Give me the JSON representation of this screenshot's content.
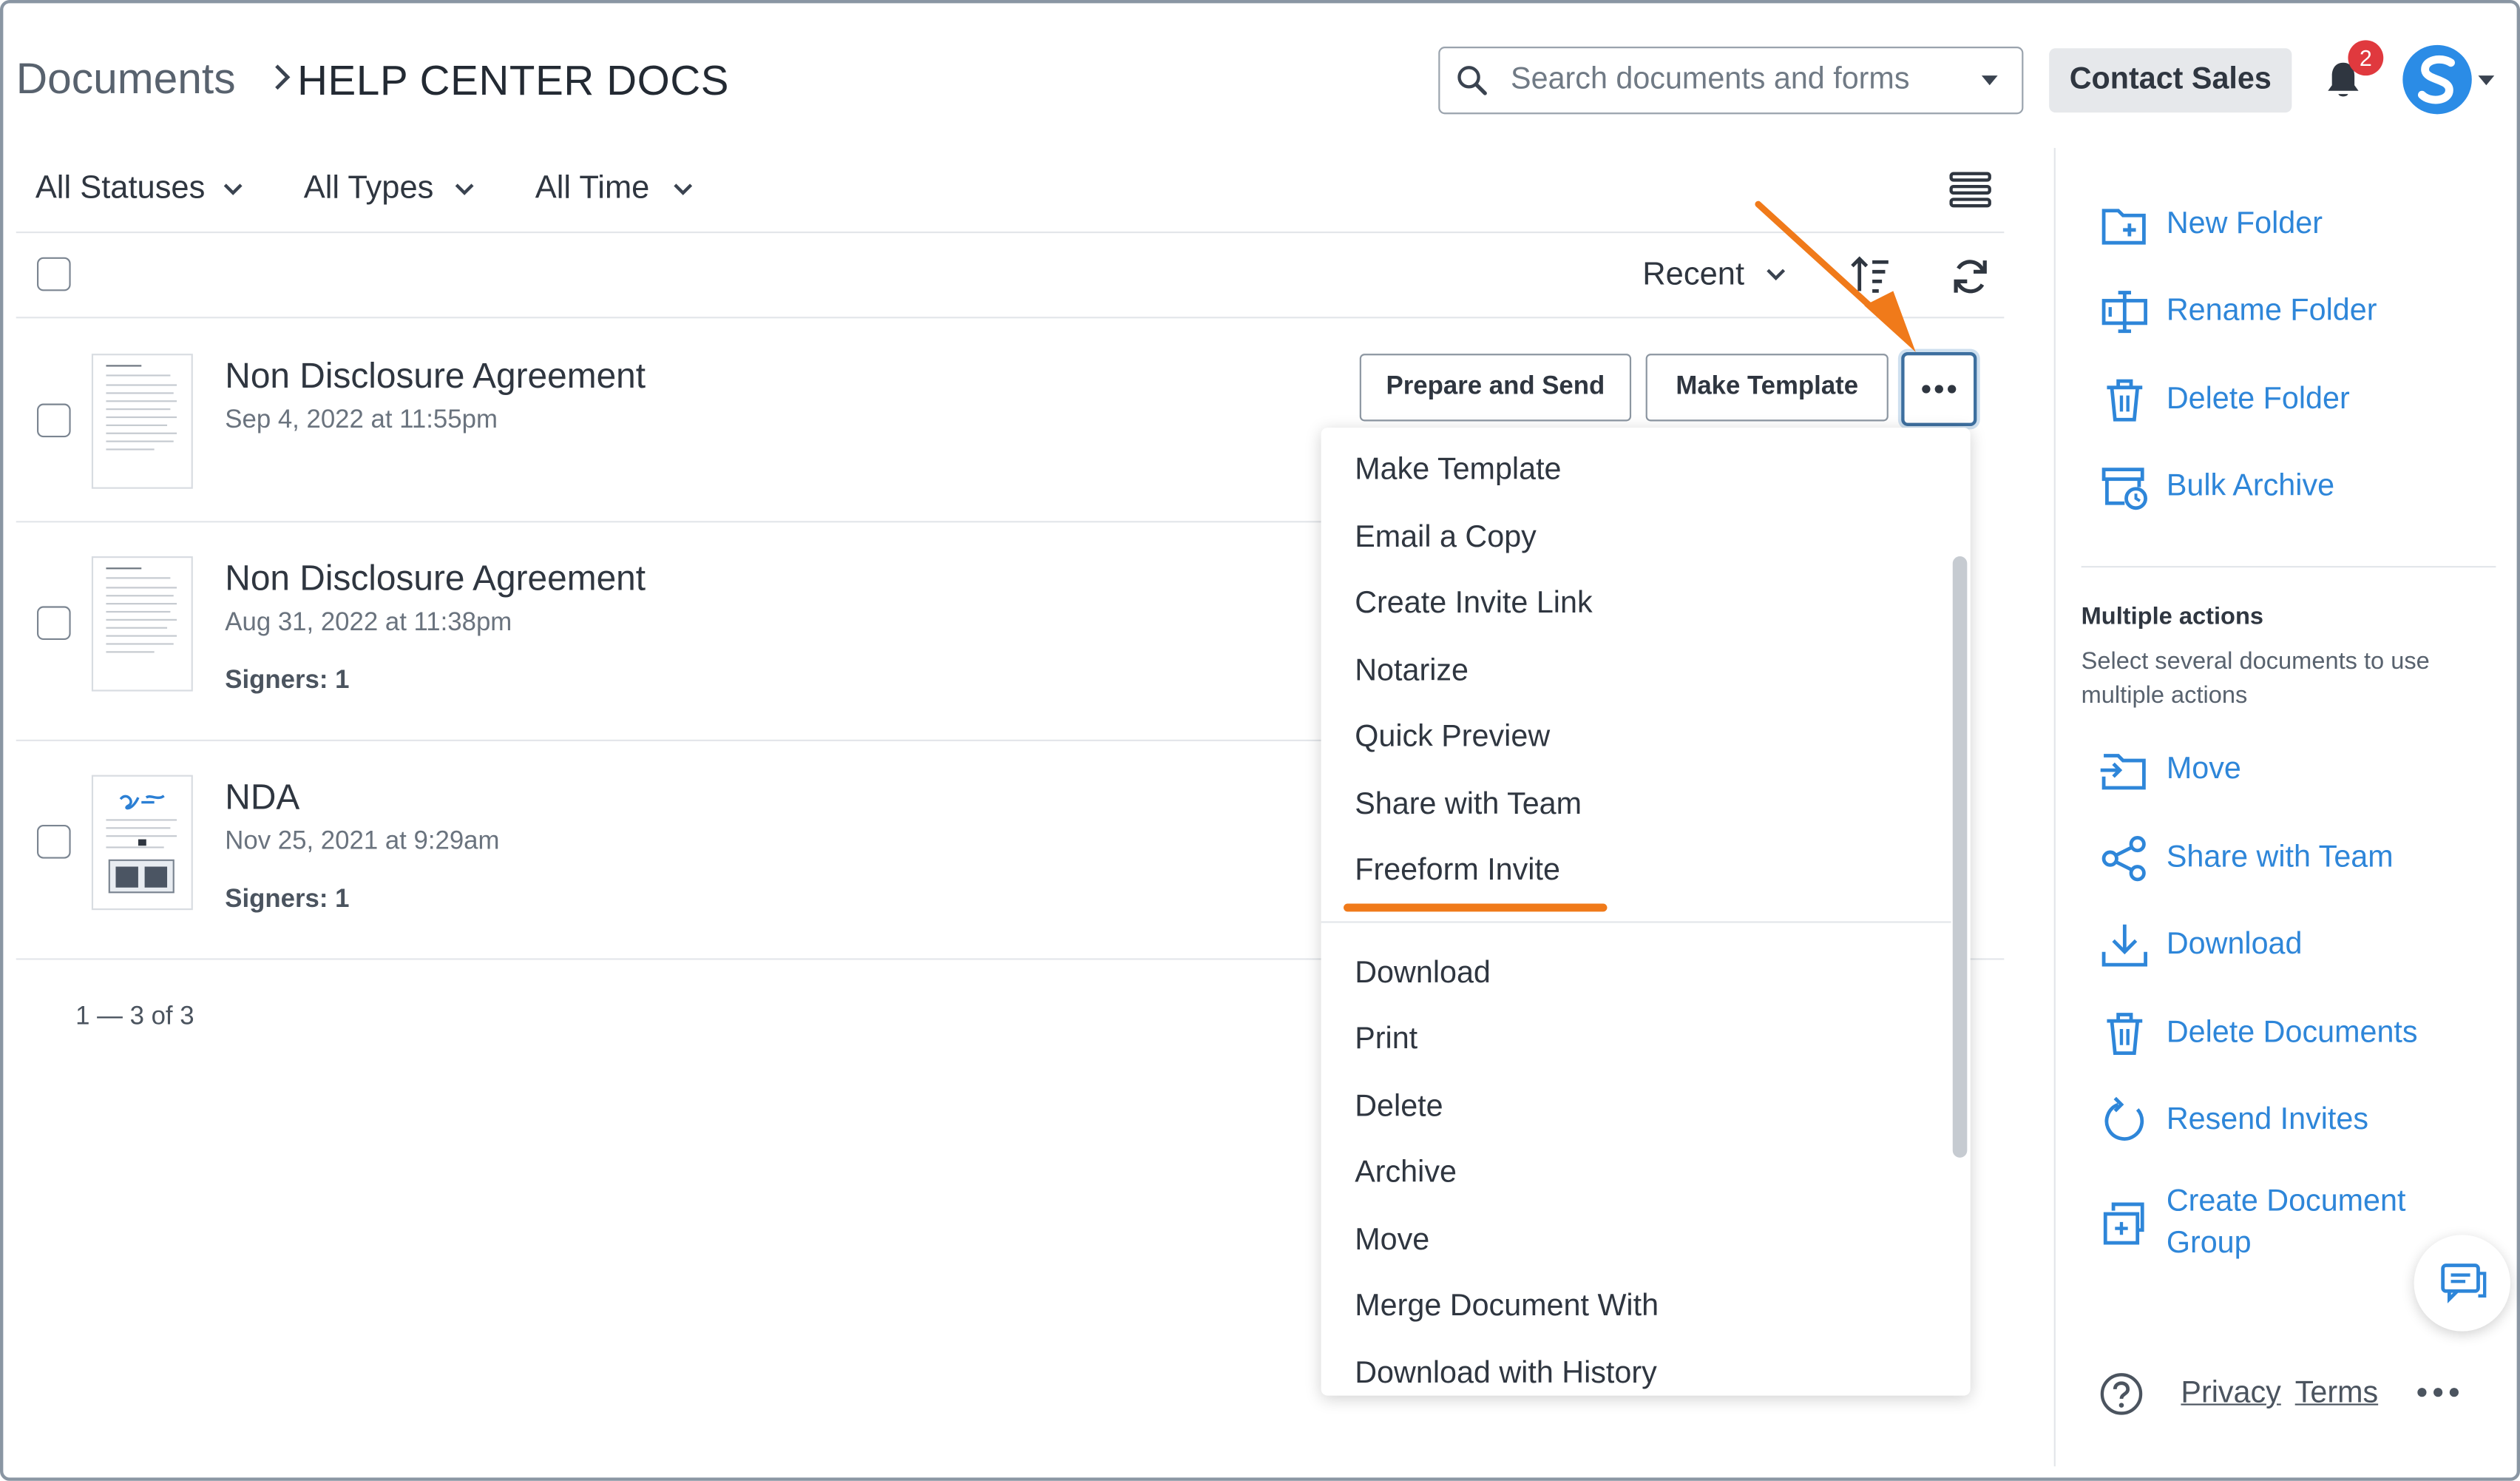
{
  "header": {
    "breadcrumb_root": "Documents",
    "breadcrumb_current": "HELP CENTER DOCS",
    "search_placeholder": "Search documents and forms",
    "contact_sales": "Contact Sales",
    "notification_count": "2"
  },
  "filters": {
    "status": "All Statuses",
    "type": "All Types",
    "time": "All Time"
  },
  "toolbar": {
    "sort_label": "Recent"
  },
  "documents": [
    {
      "title": "Non Disclosure Agreement",
      "date": "Sep 4, 2022 at 11:55pm",
      "signers": ""
    },
    {
      "title": "Non Disclosure Agreement",
      "date": "Aug 31, 2022 at 11:38pm",
      "signers": "Signers: 1"
    },
    {
      "title": "NDA",
      "date": "Nov 25, 2021 at 9:29am",
      "signers": "Signers: 1"
    }
  ],
  "row_actions": {
    "prepare_send": "Prepare and Send",
    "make_template": "Make Template"
  },
  "context_menu": {
    "items": [
      "Make Template",
      "Email a Copy",
      "Create Invite Link",
      "Notarize",
      "Quick Preview",
      "Share with Team",
      "Freeform Invite"
    ],
    "items2": [
      "Download",
      "Print",
      "Delete",
      "Archive",
      "Move",
      "Merge Document With",
      "Download with History"
    ]
  },
  "pagination": "1 — 3 of 3",
  "sidebar": {
    "folder_actions": [
      "New Folder",
      "Rename Folder",
      "Delete Folder",
      "Bulk Archive"
    ],
    "multiple_heading": "Multiple actions",
    "multiple_desc": "Select several documents to use multiple actions",
    "multi_actions": [
      "Move",
      "Share with Team",
      "Download",
      "Delete Documents",
      "Resend Invites",
      "Create Document Group"
    ],
    "footer": {
      "privacy": "Privacy",
      "terms": "Terms"
    }
  },
  "colors": {
    "accent_blue": "#2e86d9",
    "annotation_orange": "#f07a1a",
    "badge_red": "#e0393e"
  }
}
